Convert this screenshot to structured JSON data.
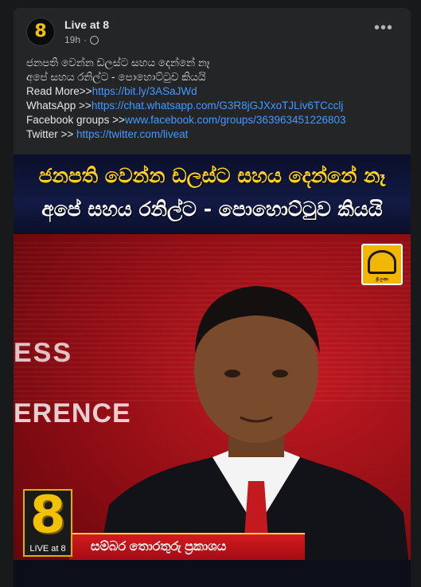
{
  "post": {
    "page_name": "Live at 8",
    "time": "19h",
    "time_separator": "·",
    "avatar_label": "8",
    "more_label": "•••",
    "lines": {
      "headline_1": "ජනපති වෙන්න ඩලස්ට සහය දෙන්නේ නෑ",
      "headline_2": "අපේ සහය රනිල්ට - පොහොට්ටුව කියයි",
      "read_more_label": "Read More>>",
      "read_more_url": "https://bit.ly/3ASaJWd",
      "whatsapp_label": "WhatsApp >>",
      "whatsapp_url": "https://chat.whatsapp.com/G3R8jGJXxoTJLiv6TCcclj",
      "facebook_label": "Facebook groups >>",
      "facebook_url": "www.facebook.com/groups/363963451226803",
      "twitter_label": "Twitter >> ",
      "twitter_url": "https://twitter.com/liveat"
    }
  },
  "image": {
    "banner_line_1": "ජනපති වෙන්න ඩලස්ට සහය දෙන්නේ නෑ",
    "banner_line_2": "අපේ සහය රනිල්ට - පොහොට්ටුව කියයි",
    "bg_text_1": "ESS",
    "bg_text_2": "ERENCE",
    "lower_third": "සම්බර තොරතුරු ප්‍රකාශය",
    "logo_number": "8",
    "logo_label": "LIVE at 8",
    "channel_logo_label": "ශ්‍රී ලංකා"
  },
  "colors": {
    "link": "#4599ff",
    "card_bg": "#242526",
    "banner_yellow": "#ffd21f",
    "news_red": "#c41a22"
  },
  "icons": [
    "globe-icon",
    "more-options-icon",
    "channel-logo-icon",
    "live-at-8-logo"
  ]
}
